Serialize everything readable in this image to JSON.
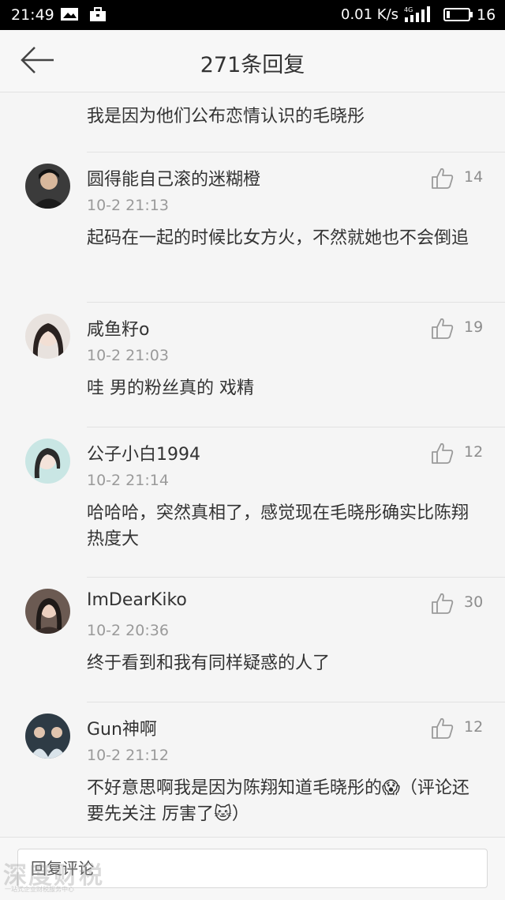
{
  "status_bar": {
    "time": "21:49",
    "net_speed": "0.01 K/s",
    "network": "4G",
    "battery": "16",
    "battery_level": 0.16
  },
  "header": {
    "title": "271条回复",
    "back_icon": "arrow-left-icon"
  },
  "continued_text": "我是因为他们公布恋情认识的毛晓彤",
  "comments": [
    {
      "name": "圆得能自己滚的迷糊橙",
      "time": "10-2 21:13",
      "likes": "14",
      "text": "起码在一起的时候比女方火，不然就她也不会倒追"
    },
    {
      "name": "咸鱼籽o",
      "time": "10-2 21:03",
      "likes": "19",
      "text": "哇 男的粉丝真的  戏精"
    },
    {
      "name": "公子小白1994",
      "time": "10-2 21:14",
      "likes": "12",
      "text": "哈哈哈，突然真相了，感觉现在毛晓彤确实比陈翔热度大"
    },
    {
      "name": "ImDearKiko",
      "time": "10-2 20:36",
      "likes": "30",
      "text": "终于看到和我有同样疑惑的人了"
    },
    {
      "name": "Gun神啊",
      "time": "10-2 21:12",
      "likes": "12",
      "text": "不好意思啊我是因为陈翔知道毛晓彤的😱（评论还要先关注  厉害了🐱）"
    }
  ],
  "reply_bar": {
    "placeholder": "回复评论"
  },
  "watermark": {
    "text": "深度财税",
    "sub": "一站式企业财税服务中心"
  },
  "colors": {
    "status_bg": "#000000",
    "page_bg": "#f5f5f5",
    "header_bg": "#f7f7f7",
    "meta_gray": "#9a9a9a",
    "text": "#333333"
  }
}
